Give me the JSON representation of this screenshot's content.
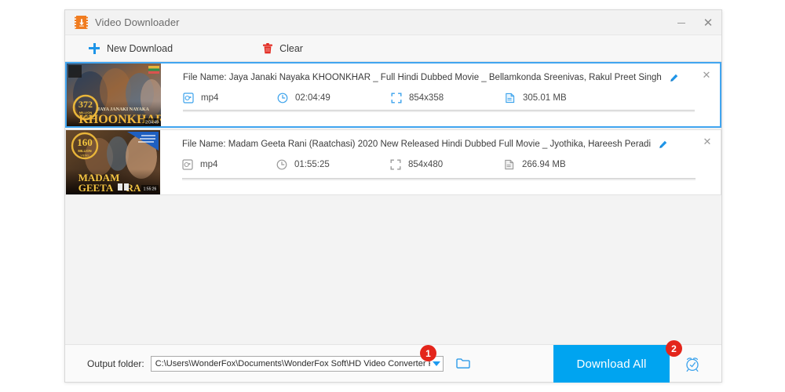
{
  "window": {
    "title": "Video Downloader",
    "app_icon": "video-download-icon",
    "minimize_label": "Minimize",
    "close_label": "Close"
  },
  "toolbar": {
    "items": [
      {
        "label": "New Download",
        "icon": "plus-icon",
        "name": "new-download-button"
      },
      {
        "label": "Clear",
        "icon": "trash-icon",
        "name": "clear-button"
      }
    ]
  },
  "downloads": [
    {
      "selected": true,
      "file_name": "File Name: Jaya Janaki Nayaka KHOONKHAR _ Full Hindi Dubbed Movie _ Bellamkonda Sreenivas, Rakul Preet Singh",
      "format": "mp4",
      "duration": "02:04:49",
      "resolution": "854x358",
      "size": "305.01 MB",
      "thumb_badge_number": "372",
      "thumb_badge_sub": "MILLION VIEWS",
      "thumb_title_small": "JAYA JANAKI NAYAKA",
      "thumb_title_big": "KHOONKHAR",
      "thumb_time": "2:04:49",
      "edit_icon": "pencil-icon",
      "close_icon": "close-icon"
    },
    {
      "selected": false,
      "file_name": "File Name: Madam Geeta Rani (Raatchasi) 2020 New Released Hindi Dubbed Full Movie _ Jyothika, Hareesh Peradi",
      "format": "mp4",
      "duration": "01:55:25",
      "resolution": "854x480",
      "size": "266.94 MB",
      "thumb_badge_number": "160",
      "thumb_badge_sub": "MILLION VIEWS",
      "thumb_title_small": "MADAM",
      "thumb_title_big": "GEETA RA",
      "thumb_time": "1:55:26",
      "edit_icon": "pencil-icon",
      "close_icon": "close-icon"
    }
  ],
  "bottom": {
    "output_folder_label": "Output folder:",
    "output_folder_path": "C:\\Users\\WonderFox\\Documents\\WonderFox Soft\\HD Video Converter Factory\\Download_Video\\",
    "browse_icon": "folder-icon",
    "download_all_label": "Download All",
    "alarm_icon": "alarm-clock-icon"
  },
  "annotations": [
    {
      "id": "1",
      "target": "output-folder-dropdown"
    },
    {
      "id": "2",
      "target": "download-all-button"
    }
  ],
  "colors": {
    "accent_blue": "#00a4f0",
    "selected_border": "#41a5f0",
    "badge_red": "#e4251b",
    "brand_orange": "#f07c20"
  }
}
